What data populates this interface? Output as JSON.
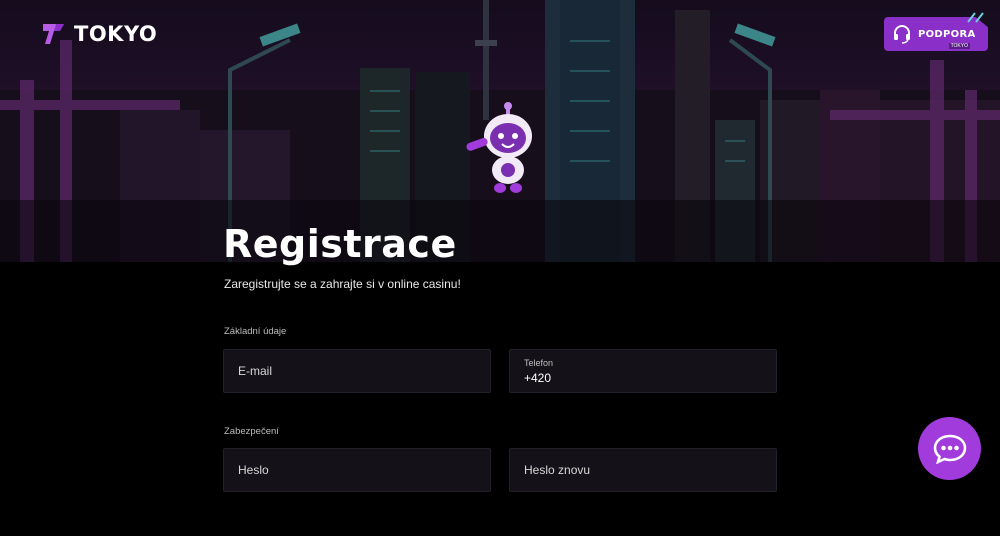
{
  "brand": {
    "name": "TOKYO"
  },
  "support": {
    "label": "PODPORA",
    "sub": "TOKYO"
  },
  "page": {
    "title": "Registrace",
    "subtitle": "Zaregistrujte se a zahrajte si v online casinu!"
  },
  "sections": {
    "basic": "Základní údaje",
    "security": "Zabezpečení"
  },
  "fields": {
    "email": {
      "placeholder": "E-mail"
    },
    "phone": {
      "label": "Telefon",
      "value": "+420"
    },
    "password": {
      "placeholder": "Heslo"
    },
    "password_repeat": {
      "placeholder": "Heslo znovu"
    }
  },
  "icons": {
    "logo": "tokyo-logo-icon",
    "support": "headset-icon",
    "chat": "chat-bubble-icon",
    "mascot": "robot-mascot-icon"
  },
  "colors": {
    "accent": "#a13bdc",
    "support_bg": "#8b2fc9",
    "field_bg": "#141218",
    "background": "#000000"
  }
}
